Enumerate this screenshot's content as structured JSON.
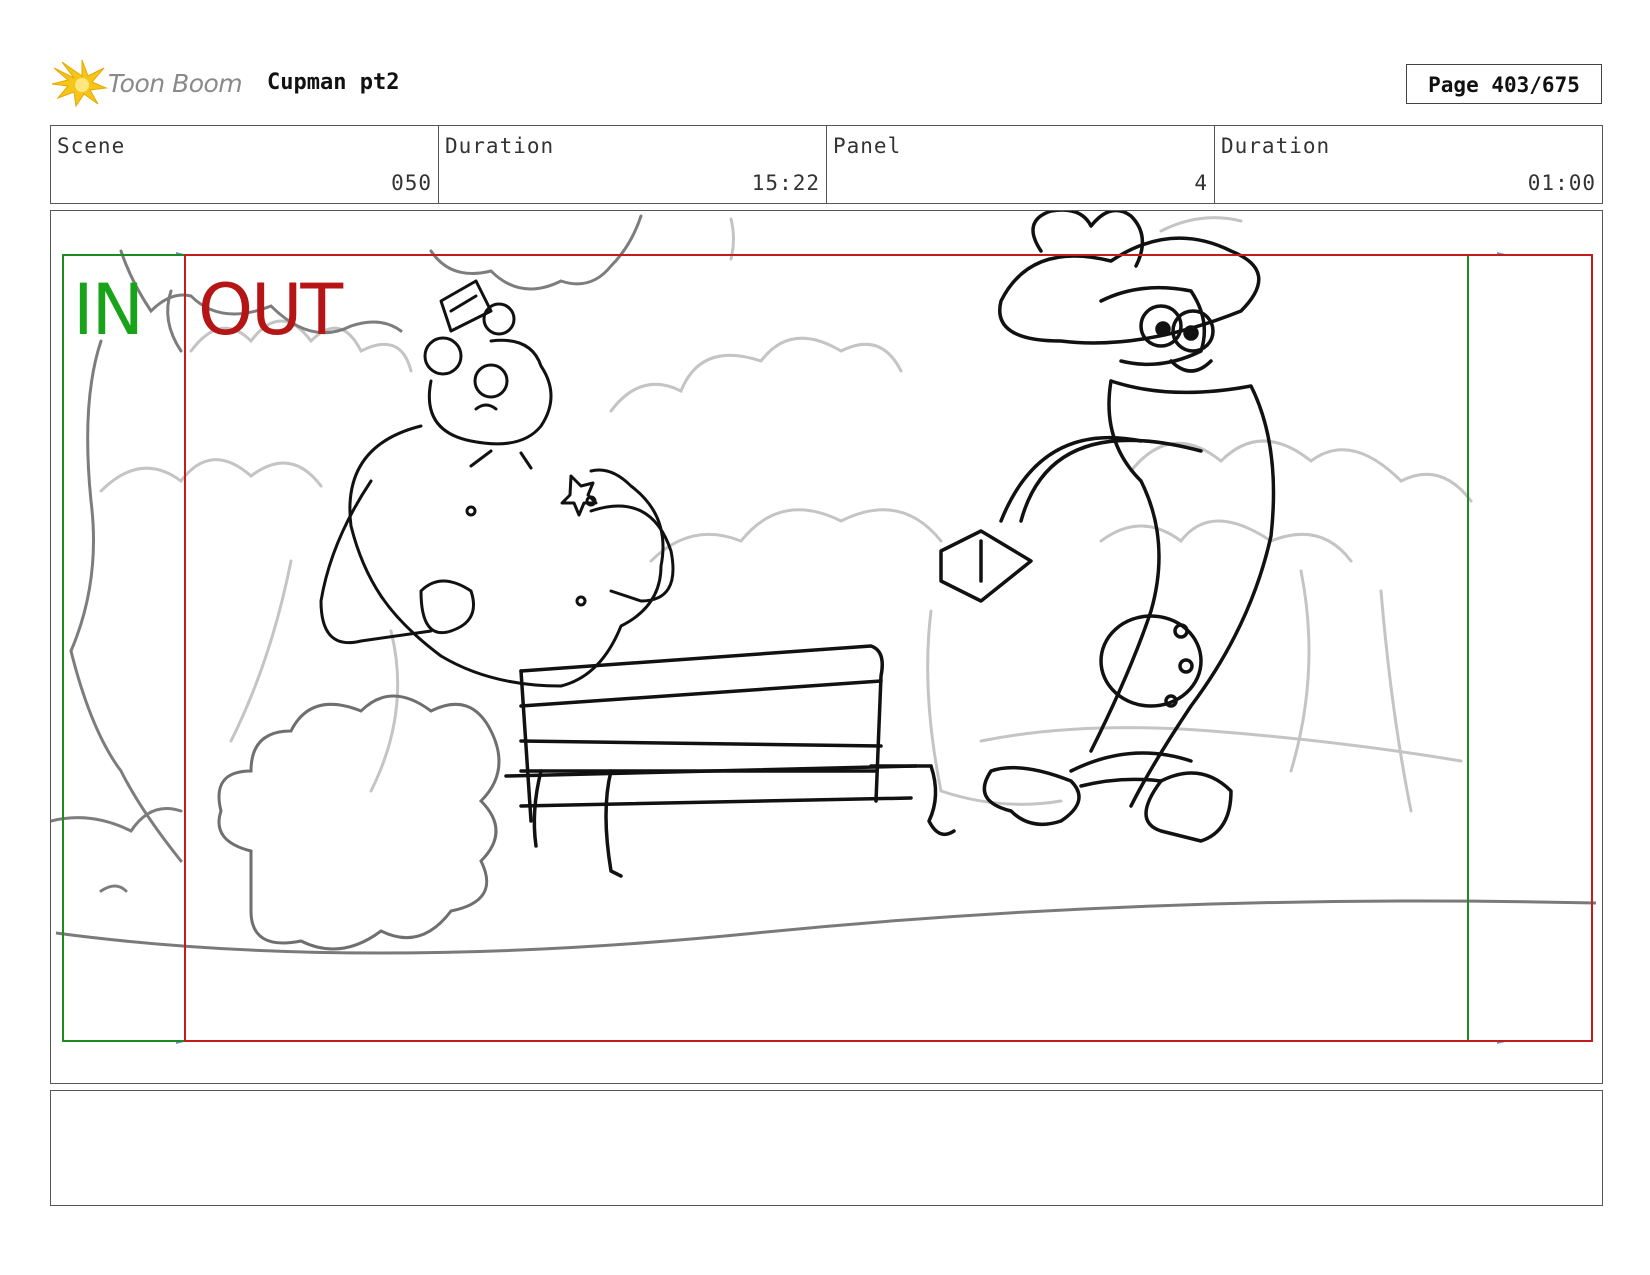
{
  "header": {
    "logo_text": "Toon Boom",
    "project_title": "Cupman pt2",
    "page_label": "Page 403/675"
  },
  "info": {
    "scene_label": "Scene",
    "scene_value": "050",
    "duration_label": "Duration",
    "duration_value": "15:22",
    "panel_label": "Panel",
    "panel_value": "4",
    "panel_duration_label": "Duration",
    "panel_duration_value": "01:00"
  },
  "frame_labels": {
    "in": "IN",
    "out": "OUT"
  },
  "colors": {
    "in_frame": "#1f8a1f",
    "out_frame": "#c21d1d",
    "logo_flame": "#f5c518"
  }
}
